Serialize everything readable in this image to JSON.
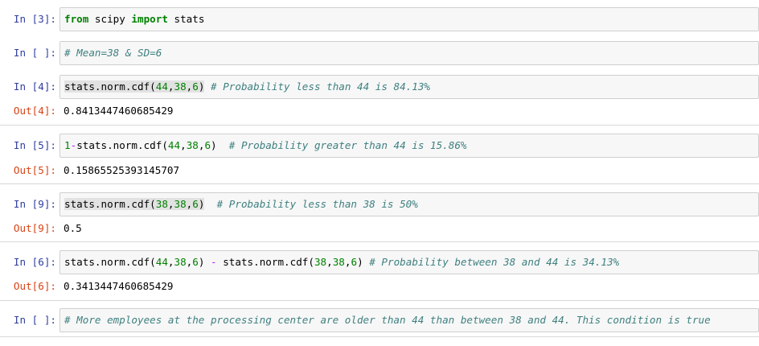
{
  "cells": [
    {
      "prompt": "In [3]:",
      "segments": [
        {
          "t": "from",
          "c": "kw"
        },
        {
          "t": " scipy ",
          "c": ""
        },
        {
          "t": "import",
          "c": "kw"
        },
        {
          "t": " stats",
          "c": ""
        }
      ]
    },
    {
      "prompt": "In [ ]:",
      "segments": [
        {
          "t": "# Mean=38 & SD=6",
          "c": "cm"
        }
      ]
    },
    {
      "prompt": "In [4]:",
      "segments": [
        {
          "t": "stats.norm.cdf(",
          "c": "hl"
        },
        {
          "t": "44",
          "c": "hl num"
        },
        {
          "t": ",",
          "c": "hl"
        },
        {
          "t": "38",
          "c": "hl num"
        },
        {
          "t": ",",
          "c": "hl"
        },
        {
          "t": "6",
          "c": "hl num"
        },
        {
          "t": ")",
          "c": "hl"
        },
        {
          "t": " ",
          "c": ""
        },
        {
          "t": "# Probability less than 44 is 84.13%",
          "c": "cm"
        }
      ],
      "out_prompt": "Out[4]:",
      "output": "0.8413447460685429"
    },
    {
      "prompt": "In [5]:",
      "segments": [
        {
          "t": "1",
          "c": "num"
        },
        {
          "t": "-",
          "c": "op"
        },
        {
          "t": "stats.norm.cdf(",
          "c": ""
        },
        {
          "t": "44",
          "c": "num"
        },
        {
          "t": ",",
          "c": ""
        },
        {
          "t": "38",
          "c": "num"
        },
        {
          "t": ",",
          "c": ""
        },
        {
          "t": "6",
          "c": "num"
        },
        {
          "t": ")  ",
          "c": ""
        },
        {
          "t": "# Probability greater than 44 is 15.86%",
          "c": "cm"
        }
      ],
      "out_prompt": "Out[5]:",
      "output": "0.15865525393145707"
    },
    {
      "prompt": "In [9]:",
      "segments": [
        {
          "t": "stats.norm.cdf(",
          "c": "hl"
        },
        {
          "t": "38",
          "c": "hl num"
        },
        {
          "t": ",",
          "c": "hl"
        },
        {
          "t": "38",
          "c": "hl num"
        },
        {
          "t": ",",
          "c": "hl"
        },
        {
          "t": "6",
          "c": "hl num"
        },
        {
          "t": ")",
          "c": "hl"
        },
        {
          "t": "  ",
          "c": ""
        },
        {
          "t": "# Probability less than 38 is 50%",
          "c": "cm"
        }
      ],
      "out_prompt": "Out[9]:",
      "output": "0.5"
    },
    {
      "prompt": "In [6]:",
      "segments": [
        {
          "t": "stats.norm.cdf(",
          "c": ""
        },
        {
          "t": "44",
          "c": "num"
        },
        {
          "t": ",",
          "c": ""
        },
        {
          "t": "38",
          "c": "num"
        },
        {
          "t": ",",
          "c": ""
        },
        {
          "t": "6",
          "c": "num"
        },
        {
          "t": ") ",
          "c": ""
        },
        {
          "t": "-",
          "c": "op"
        },
        {
          "t": " stats.norm.cdf(",
          "c": ""
        },
        {
          "t": "38",
          "c": "num"
        },
        {
          "t": ",",
          "c": ""
        },
        {
          "t": "38",
          "c": "num"
        },
        {
          "t": ",",
          "c": ""
        },
        {
          "t": "6",
          "c": "num"
        },
        {
          "t": ") ",
          "c": ""
        },
        {
          "t": "# Probability between 38 and 44 is 34.13%",
          "c": "cm"
        }
      ],
      "out_prompt": "Out[6]:",
      "output": "0.3413447460685429"
    },
    {
      "prompt": "In [ ]:",
      "segments": [
        {
          "t": "# More employees at the processing center are older than 44 than between 38 and 44. This condition is true",
          "c": "cm"
        }
      ]
    }
  ]
}
